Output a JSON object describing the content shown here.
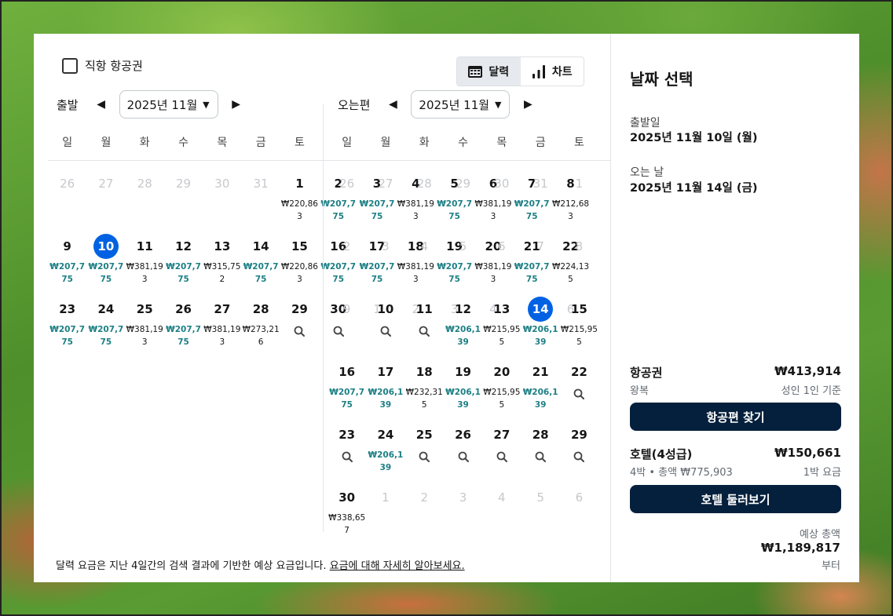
{
  "direct_flights": {
    "label": "직항 항공권"
  },
  "view_toggle": {
    "calendar": "달력",
    "chart": "차트"
  },
  "depart": {
    "label": "출발",
    "month": "2025년 11월",
    "weekdays": [
      "일",
      "월",
      "화",
      "수",
      "목",
      "금",
      "토"
    ],
    "days": [
      {
        "n": "26",
        "m": true
      },
      {
        "n": "27",
        "m": true
      },
      {
        "n": "28",
        "m": true
      },
      {
        "n": "29",
        "m": true
      },
      {
        "n": "30",
        "m": true
      },
      {
        "n": "31",
        "m": true
      },
      {
        "n": "1",
        "p": "₩220,863"
      },
      {
        "n": "2",
        "p": "₩207,775",
        "low": true
      },
      {
        "n": "3",
        "p": "₩207,775",
        "low": true
      },
      {
        "n": "4",
        "p": "₩381,193"
      },
      {
        "n": "5",
        "p": "₩207,775",
        "low": true
      },
      {
        "n": "6",
        "p": "₩381,193"
      },
      {
        "n": "7",
        "p": "₩207,775",
        "low": true
      },
      {
        "n": "8",
        "p": "₩212,683"
      },
      {
        "n": "9",
        "p": "₩207,775",
        "low": true
      },
      {
        "n": "10",
        "p": "₩207,775",
        "low": true,
        "sel": true
      },
      {
        "n": "11",
        "p": "₩381,193"
      },
      {
        "n": "12",
        "p": "₩207,775",
        "low": true
      },
      {
        "n": "13",
        "p": "₩315,752"
      },
      {
        "n": "14",
        "p": "₩207,775",
        "low": true
      },
      {
        "n": "15",
        "p": "₩220,863"
      },
      {
        "n": "16",
        "p": "₩207,775",
        "low": true
      },
      {
        "n": "17",
        "p": "₩207,775",
        "low": true
      },
      {
        "n": "18",
        "p": "₩381,193"
      },
      {
        "n": "19",
        "p": "₩207,775",
        "low": true
      },
      {
        "n": "20",
        "p": "₩381,193"
      },
      {
        "n": "21",
        "p": "₩207,775",
        "low": true
      },
      {
        "n": "22",
        "p": "₩224,135"
      },
      {
        "n": "23",
        "p": "₩207,775",
        "low": true
      },
      {
        "n": "24",
        "p": "₩207,775",
        "low": true
      },
      {
        "n": "25",
        "p": "₩381,193"
      },
      {
        "n": "26",
        "p": "₩207,775",
        "low": true
      },
      {
        "n": "27",
        "p": "₩381,193"
      },
      {
        "n": "28",
        "p": "₩273,216"
      },
      {
        "n": "29",
        "s": true
      },
      {
        "n": "30",
        "s": true
      },
      {
        "n": "1",
        "m": true
      },
      {
        "n": "2",
        "m": true
      },
      {
        "n": "3",
        "m": true
      },
      {
        "n": "4",
        "m": true
      },
      {
        "n": "5",
        "m": true
      },
      {
        "n": "6",
        "m": true
      }
    ]
  },
  "return": {
    "label": "오는편",
    "month": "2025년 11월",
    "weekdays": [
      "일",
      "월",
      "화",
      "수",
      "목",
      "금",
      "토"
    ],
    "days": [
      {
        "n": "26",
        "m": true
      },
      {
        "n": "27",
        "m": true
      },
      {
        "n": "28",
        "m": true
      },
      {
        "n": "29",
        "m": true
      },
      {
        "n": "30",
        "m": true
      },
      {
        "n": "31",
        "m": true
      },
      {
        "n": "1",
        "m": true
      },
      {
        "n": "2",
        "m": true
      },
      {
        "n": "3",
        "m": true
      },
      {
        "n": "4",
        "m": true
      },
      {
        "n": "5",
        "m": true
      },
      {
        "n": "6",
        "m": true
      },
      {
        "n": "7",
        "m": true
      },
      {
        "n": "8",
        "m": true
      },
      {
        "n": "9",
        "m": true
      },
      {
        "n": "10",
        "s": true
      },
      {
        "n": "11",
        "s": true
      },
      {
        "n": "12",
        "p": "₩206,139",
        "low": true
      },
      {
        "n": "13",
        "p": "₩215,955"
      },
      {
        "n": "14",
        "p": "₩206,139",
        "low": true,
        "sel": true
      },
      {
        "n": "15",
        "p": "₩215,955"
      },
      {
        "n": "16",
        "p": "₩207,775",
        "low": true
      },
      {
        "n": "17",
        "p": "₩206,139",
        "low": true
      },
      {
        "n": "18",
        "p": "₩232,315"
      },
      {
        "n": "19",
        "p": "₩206,139",
        "low": true
      },
      {
        "n": "20",
        "p": "₩215,955"
      },
      {
        "n": "21",
        "p": "₩206,139",
        "low": true
      },
      {
        "n": "22",
        "s": true
      },
      {
        "n": "23",
        "s": true
      },
      {
        "n": "24",
        "p": "₩206,139",
        "low": true
      },
      {
        "n": "25",
        "s": true
      },
      {
        "n": "26",
        "s": true
      },
      {
        "n": "27",
        "s": true
      },
      {
        "n": "28",
        "s": true
      },
      {
        "n": "29",
        "s": true
      },
      {
        "n": "30",
        "p": "₩338,657"
      },
      {
        "n": "1",
        "m": true
      },
      {
        "n": "2",
        "m": true
      },
      {
        "n": "3",
        "m": true
      },
      {
        "n": "4",
        "m": true
      },
      {
        "n": "5",
        "m": true
      },
      {
        "n": "6",
        "m": true
      }
    ]
  },
  "footnote": {
    "text": "달력 요금은 지난 4일간의 검색 결과에 기반한 예상 요금입니다. ",
    "link": "요금에 대해 자세히 알아보세요."
  },
  "summary": {
    "title": "날짜 선택",
    "depart_label": "출발일",
    "depart_value": "2025년 11월 10일 (월)",
    "return_label": "오는 날",
    "return_value": "2025년 11월 14일 (금)",
    "flight_label": "항공권",
    "flight_price": "₩413,914",
    "flight_sub": "왕복",
    "flight_basis": "성인 1인 기준",
    "flight_button": "항공편 찾기",
    "hotel_label": "호텔(4성급)",
    "hotel_price": "₩150,661",
    "hotel_sub": "4박 • 총액 ₩775,903",
    "hotel_basis": "1박 요금",
    "hotel_button": "호텔 둘러보기",
    "total_label": "예상 총액",
    "total_value": "₩1,189,817",
    "total_suffix": "부터"
  },
  "colors": {
    "accent": "#0062e3",
    "low_price": "#1c7f84",
    "button": "#05203c"
  }
}
